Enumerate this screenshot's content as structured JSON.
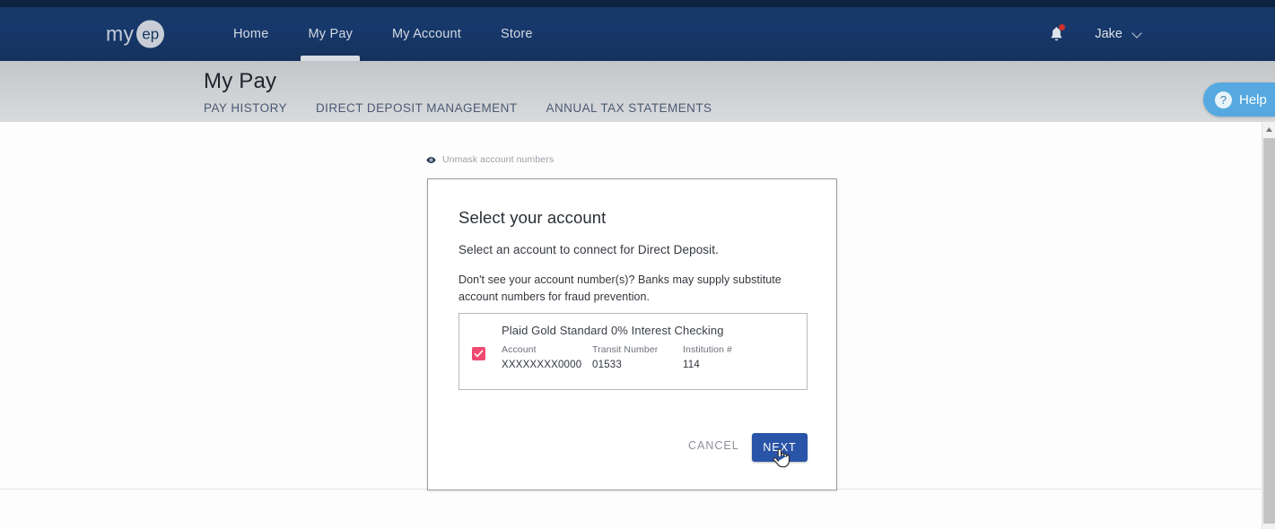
{
  "brand": {
    "word": "my",
    "circle": "ep"
  },
  "nav": {
    "items": [
      {
        "label": "Home",
        "active": false
      },
      {
        "label": "My Pay",
        "active": true
      },
      {
        "label": "My Account",
        "active": false
      },
      {
        "label": "Store",
        "active": false
      }
    ],
    "notification_icon": "bell-icon",
    "user_name": "Jake",
    "user_chevron": "chevron-down-icon"
  },
  "page": {
    "title": "My Pay",
    "subtabs": [
      "PAY HISTORY",
      "DIRECT DEPOSIT MANAGEMENT",
      "ANNUAL TAX STATEMENTS"
    ]
  },
  "unmask": {
    "icon": "eye-icon",
    "label": "Unmask account numbers"
  },
  "modal": {
    "heading": "Select your account",
    "subheading": "Select an account to connect for Direct Deposit.",
    "note": "Don't see your account number(s)? Banks may supply substitute account numbers for fraud prevention.",
    "account": {
      "name": "Plaid Gold Standard 0% Interest Checking",
      "selected": true,
      "columns": [
        {
          "label": "Account",
          "value": "XXXXXXXX0000"
        },
        {
          "label": "Transit Number",
          "value": "01533"
        },
        {
          "label": "Institution #",
          "value": "114"
        }
      ]
    },
    "cancel_label": "CANCEL",
    "next_label": "NEXT"
  },
  "help": {
    "icon": "question-circle-icon",
    "label": "Help"
  },
  "colors": {
    "header_navy": "#16355f",
    "top_strip": "#0b2240",
    "primary_button": "#2a54a8",
    "checkbox_pink": "#ef4a72",
    "help_blue": "#55a9e0",
    "notification_red": "#d0302c",
    "subtab_text": "#4a5a73"
  }
}
